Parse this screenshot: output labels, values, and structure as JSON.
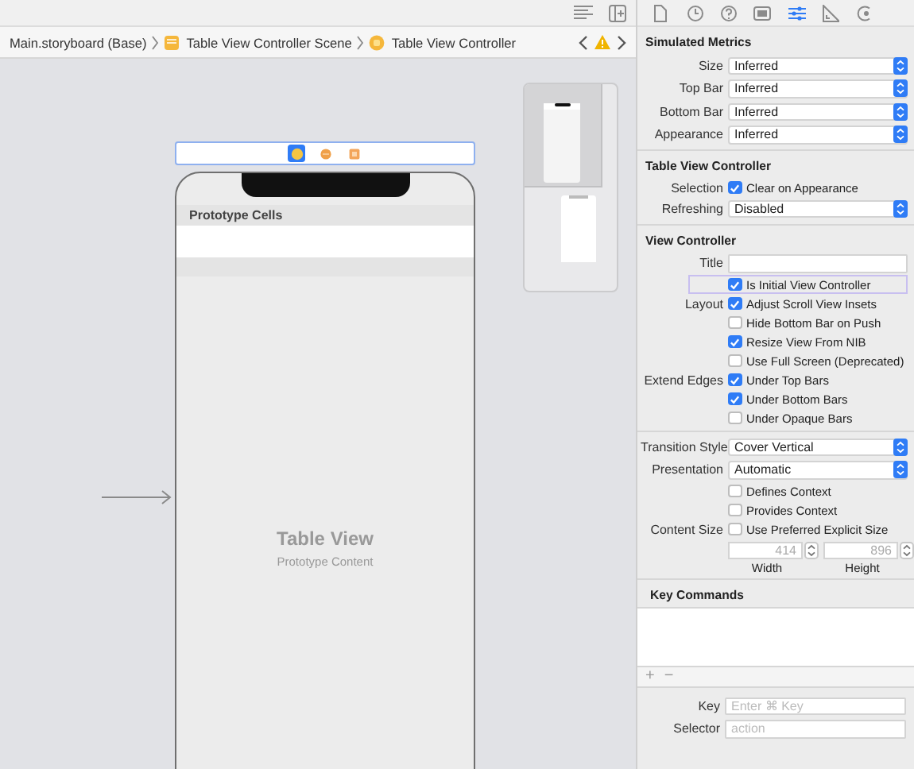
{
  "breadcrumb": [
    {
      "kind": "file",
      "label": "Main.storyboard (Base)"
    },
    {
      "kind": "scene",
      "label": "Table View Controller Scene"
    },
    {
      "kind": "controller",
      "label": "Table View Controller"
    }
  ],
  "scene_dock": [
    {
      "kind": "controller",
      "selected": true
    },
    {
      "kind": "responder",
      "selected": false
    },
    {
      "kind": "exit",
      "selected": false
    }
  ],
  "table_view": {
    "section_header": "Prototype Cells",
    "title": "Table View",
    "subtitle": "Prototype Content"
  },
  "inspector_tabs": [
    {
      "kind": "file",
      "selected": false
    },
    {
      "kind": "history",
      "selected": false
    },
    {
      "kind": "help",
      "selected": false
    },
    {
      "kind": "identity",
      "selected": false
    },
    {
      "kind": "attributes",
      "selected": true
    },
    {
      "kind": "size",
      "selected": false
    },
    {
      "kind": "connections",
      "selected": false
    }
  ],
  "sections": [
    {
      "title": "Simulated Metrics",
      "rows": [
        {
          "kind": "select",
          "label": "Size",
          "value": "Inferred"
        },
        {
          "kind": "select",
          "label": "Top Bar",
          "value": "Inferred"
        },
        {
          "kind": "select",
          "label": "Bottom Bar",
          "value": "Inferred"
        },
        {
          "kind": "select",
          "label": "Appearance",
          "value": "Inferred"
        }
      ]
    },
    {
      "title": "Table View Controller",
      "rows": [
        {
          "kind": "check",
          "label": "Selection",
          "text": "Clear on Appearance",
          "checked": true,
          "focused": false
        },
        {
          "kind": "select",
          "label": "Refreshing",
          "value": "Disabled"
        }
      ]
    },
    {
      "title": "View Controller",
      "rows": [
        {
          "kind": "text",
          "label": "Title"
        },
        {
          "kind": "check",
          "text": "Is Initial View Controller",
          "checked": true,
          "focused": true
        },
        {
          "kind": "check",
          "label": "Layout",
          "text": "Adjust Scroll View Insets",
          "checked": true,
          "focused": false
        },
        {
          "kind": "check",
          "text": "Hide Bottom Bar on Push",
          "checked": false,
          "focused": false
        },
        {
          "kind": "check",
          "text": "Resize View From NIB",
          "checked": true,
          "focused": false
        },
        {
          "kind": "check",
          "text": "Use Full Screen (Deprecated)",
          "checked": false,
          "focused": false
        },
        {
          "kind": "check",
          "label": "Extend Edges",
          "text": "Under Top Bars",
          "checked": true,
          "focused": false
        },
        {
          "kind": "check",
          "text": "Under Bottom Bars",
          "checked": true,
          "focused": false
        },
        {
          "kind": "check",
          "text": "Under Opaque Bars",
          "checked": false,
          "focused": false
        },
        {
          "kind": "rule"
        },
        {
          "kind": "select",
          "label": "Transition Style",
          "value": "Cover Vertical"
        },
        {
          "kind": "select",
          "label": "Presentation",
          "value": "Automatic"
        },
        {
          "kind": "check",
          "text": "Defines Context",
          "checked": false,
          "focused": false
        },
        {
          "kind": "check",
          "text": "Provides Context",
          "checked": false,
          "focused": false
        },
        {
          "kind": "check",
          "label": "Content Size",
          "text": "Use Preferred Explicit Size",
          "checked": false,
          "focused": false
        },
        {
          "kind": "size",
          "fields": [
            {
              "placeholder": "414",
              "caption": "Width"
            },
            {
              "placeholder": "896",
              "caption": "Height"
            }
          ]
        }
      ]
    },
    {
      "title": "Key Commands",
      "rows": [
        {
          "kind": "list",
          "buttons": [
            "+",
            "−"
          ]
        },
        {
          "kind": "field",
          "label": "Key",
          "placeholder": "Enter ⌘ Key"
        },
        {
          "kind": "field",
          "label": "Selector",
          "placeholder": "action"
        }
      ]
    }
  ]
}
